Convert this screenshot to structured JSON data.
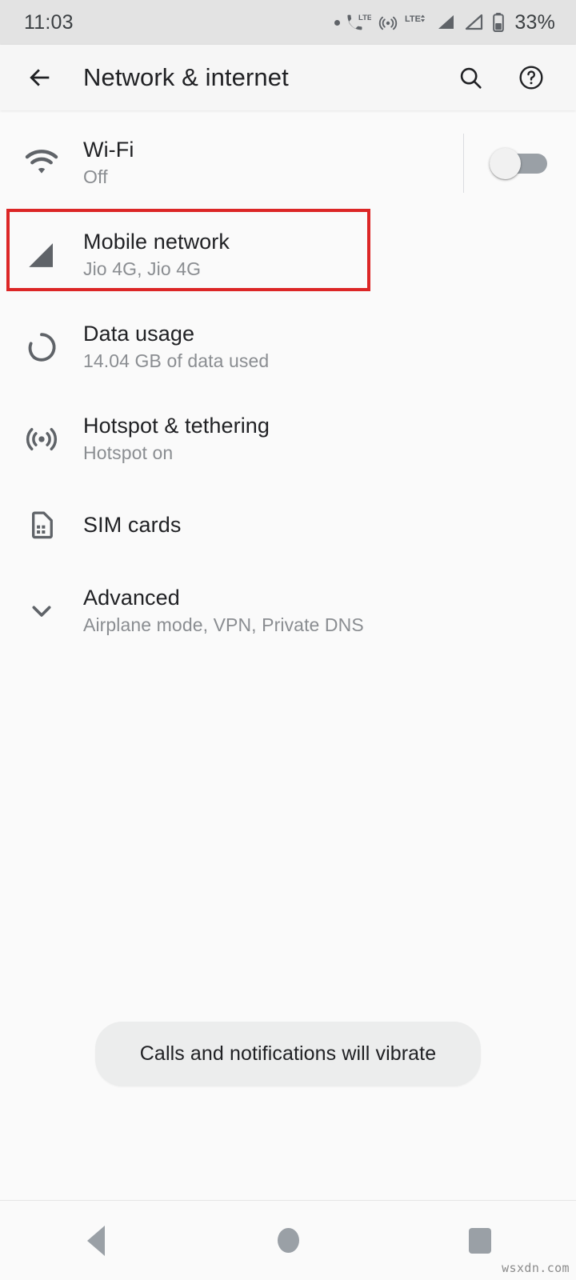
{
  "status_bar": {
    "clock": "11:03",
    "battery_percent": "33%",
    "icons": [
      "notification-dot-icon",
      "volte-phone-lte-icon",
      "hotspot-active-icon",
      "lte-data-arrows-icon",
      "signal-bars-sim1-icon",
      "signal-bars-sim2-icon",
      "battery-icon"
    ]
  },
  "app_bar": {
    "back_label": "back-arrow",
    "title": "Network & internet",
    "search_label": "search",
    "help_label": "help"
  },
  "settings": {
    "items": [
      {
        "id": "wifi",
        "icon": "wifi-icon",
        "title": "Wi-Fi",
        "subtitle": "Off",
        "trailing": "toggle-off"
      },
      {
        "id": "mobile-network",
        "icon": "signal-cellular-icon",
        "title": "Mobile network",
        "subtitle": "Jio 4G, Jio 4G",
        "trailing": "none",
        "highlighted": true
      },
      {
        "id": "data-usage",
        "icon": "data-usage-gauge-icon",
        "title": "Data usage",
        "subtitle": "14.04 GB of data used",
        "trailing": "none"
      },
      {
        "id": "hotspot-tethering",
        "icon": "hotspot-icon",
        "title": "Hotspot & tethering",
        "subtitle": "Hotspot on",
        "trailing": "none"
      },
      {
        "id": "sim-cards",
        "icon": "sim-card-icon",
        "title": "SIM cards",
        "subtitle": "",
        "trailing": "none"
      },
      {
        "id": "advanced",
        "icon": "chevron-down-icon",
        "title": "Advanced",
        "subtitle": "Airplane mode, VPN, Private DNS",
        "trailing": "none"
      }
    ]
  },
  "toast": {
    "message": "Calls and notifications will vibrate"
  },
  "nav_bar": {
    "back": "back-triangle",
    "home": "home-circle",
    "recents": "recents-square"
  },
  "watermark": "wsxdn.com",
  "colors": {
    "highlight": "#dc2626",
    "status_bar_bg": "#e3e3e3",
    "app_bar_bg": "#f6f6f6",
    "page_bg": "#fafafa",
    "title_text": "#202124",
    "subtitle_text": "#8a8d91",
    "icon_gray": "#5f6368"
  }
}
